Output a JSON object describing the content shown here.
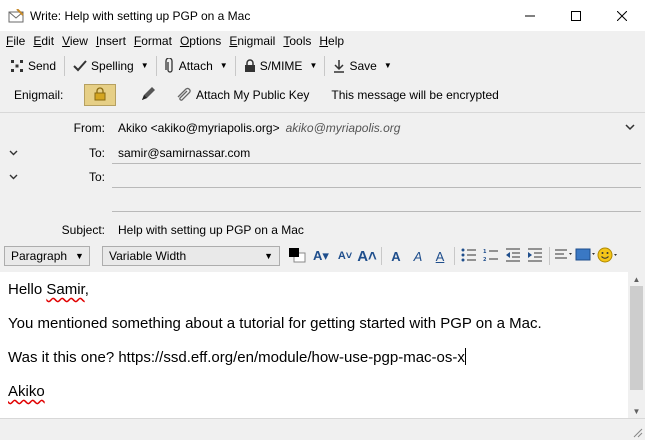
{
  "window": {
    "title": "Write: Help with setting up PGP on a Mac"
  },
  "menu": [
    {
      "key": "F",
      "rest": "ile"
    },
    {
      "key": "E",
      "rest": "dit"
    },
    {
      "key": "V",
      "rest": "iew"
    },
    {
      "key": "I",
      "rest": "nsert"
    },
    {
      "key": "F",
      "rest": "ormat"
    },
    {
      "key": "O",
      "rest": "ptions"
    },
    {
      "key": "E",
      "rest": "nigmail"
    },
    {
      "key": "T",
      "rest": "ools"
    },
    {
      "key": "H",
      "rest": "elp"
    }
  ],
  "toolbar": {
    "send": "Send",
    "spelling": "Spelling",
    "attach": "Attach",
    "smime": "S/MIME",
    "save": "Save"
  },
  "enigmail": {
    "label": "Enigmail:",
    "attach_key": "Attach My Public Key",
    "status": "This message will be encrypted",
    "lock_color": "#e6cf86"
  },
  "header": {
    "from_label": "From:",
    "from_value": "Akiko <akiko@myriapolis.org>",
    "from_identity": "akiko@myriapolis.org",
    "to_label": "To:",
    "to_value": "samir@samirnassar.com",
    "to2_label": "To:",
    "to2_value": "",
    "subject_label": "Subject:",
    "subject_value": "Help with setting up PGP on a Mac"
  },
  "format": {
    "paragraph": "Paragraph",
    "font": "Variable Width"
  },
  "body": {
    "greeting_word": "Hello",
    "greeting_name": "Samir",
    "greeting_punct": ",",
    "line1": "You mentioned something about a tutorial for getting started with PGP on a Mac.",
    "line2": "Was it this one? https://ssd.eff.org/en/module/how-use-pgp-mac-os-x",
    "signature": "Akiko"
  }
}
